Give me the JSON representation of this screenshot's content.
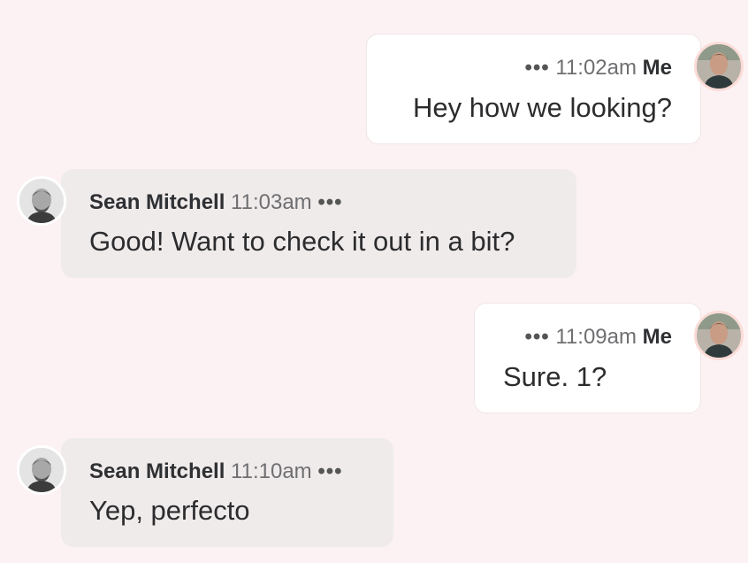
{
  "messages": [
    {
      "sender": "Me",
      "time": "11:02am",
      "text": "Hey how we looking?",
      "more": "•••"
    },
    {
      "sender": "Sean Mitchell",
      "time": "11:03am",
      "text": "Good! Want to check it out in a bit?",
      "more": "•••"
    },
    {
      "sender": "Me",
      "time": "11:09am",
      "text": "Sure. 1?",
      "more": "•••"
    },
    {
      "sender": "Sean Mitchell",
      "time": "11:10am",
      "text": "Yep, perfecto",
      "more": "•••"
    }
  ],
  "colors": {
    "background": "#fcf2f3",
    "my_bubble": "#ffffff",
    "their_bubble": "#efebeb"
  }
}
